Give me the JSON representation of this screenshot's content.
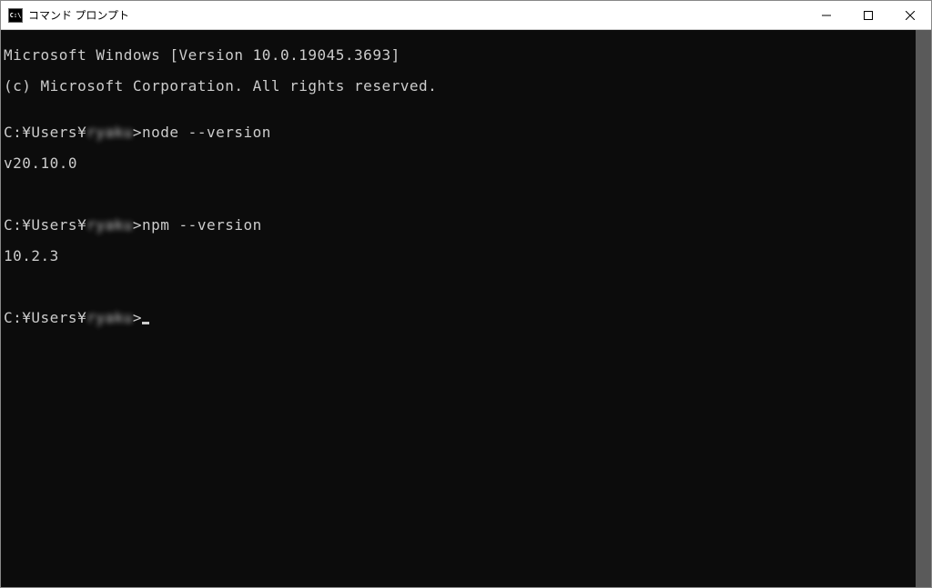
{
  "window": {
    "title": "コマンド プロンプト",
    "icon_label": "C:\\"
  },
  "terminal": {
    "lines": [
      "Microsoft Windows [Version 10.0.19045.3693]",
      "(c) Microsoft Corporation. All rights reserved.",
      ""
    ],
    "prompt_prefix": "C:¥Users¥",
    "blurred_user": "ryaku",
    "prompt_suffix": ">",
    "commands": [
      {
        "cmd": "node --version",
        "output": "v20.10.0"
      },
      {
        "cmd": "npm --version",
        "output": "10.2.3"
      }
    ]
  }
}
